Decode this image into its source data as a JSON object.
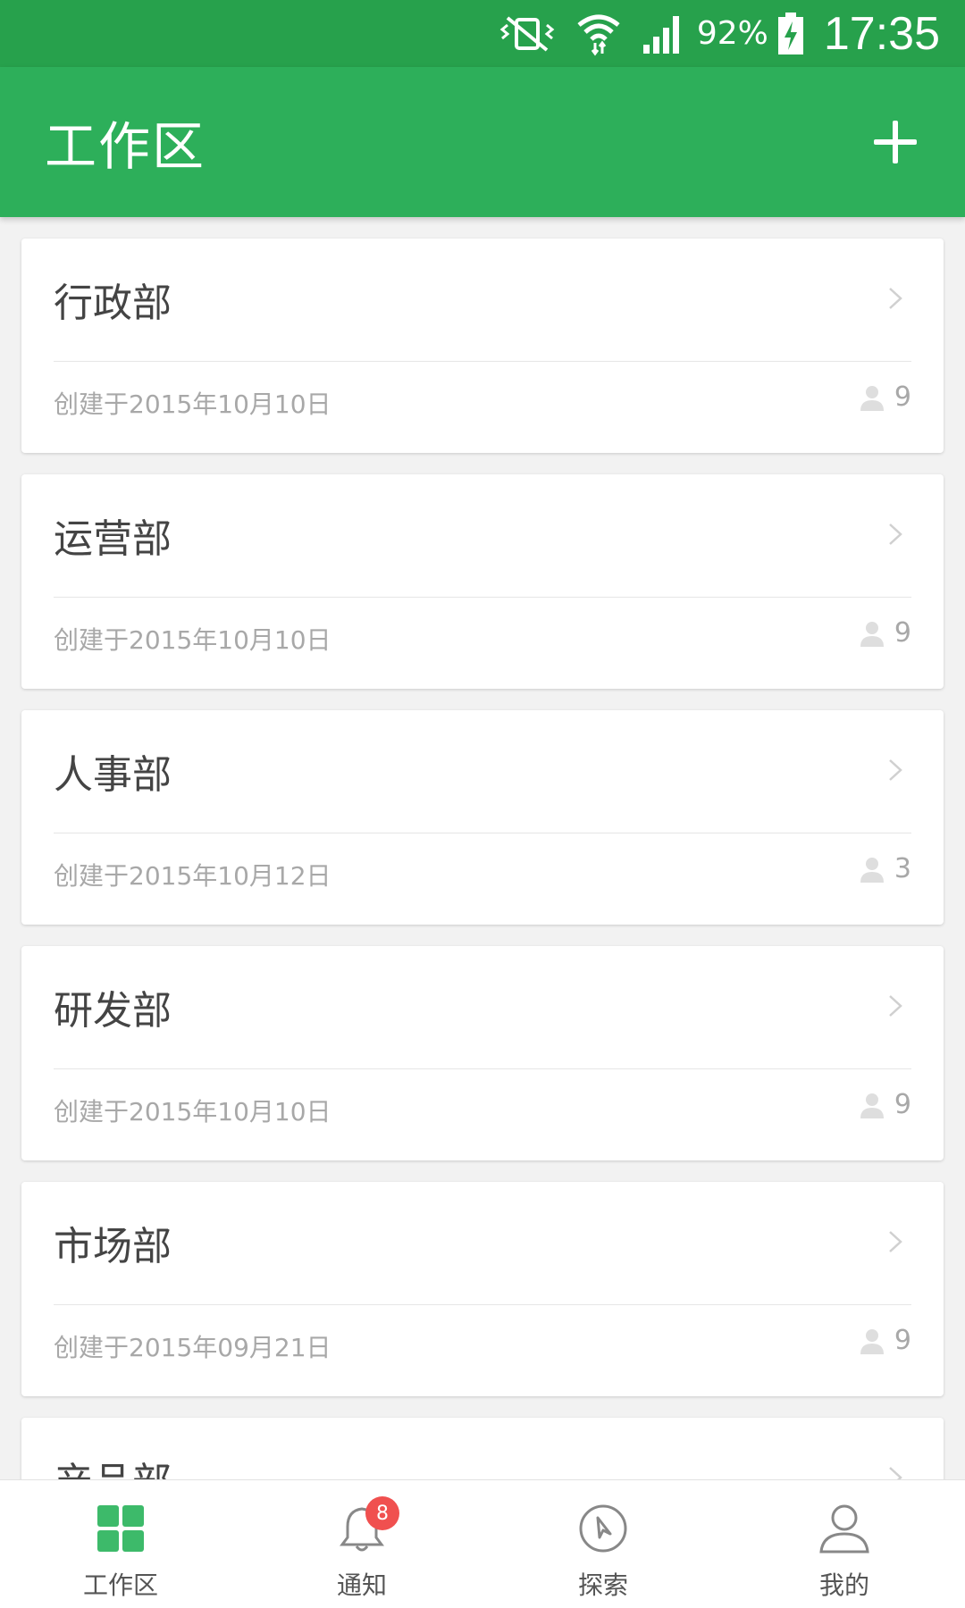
{
  "status_bar": {
    "battery": "92%",
    "time": "17:35"
  },
  "app_bar": {
    "title": "工作区",
    "add_icon": "plus-icon"
  },
  "departments": [
    {
      "name": "行政部",
      "created": "创建于2015年10月10日",
      "members": "9"
    },
    {
      "name": "运营部",
      "created": "创建于2015年10月10日",
      "members": "9"
    },
    {
      "name": "人事部",
      "created": "创建于2015年10月12日",
      "members": "3"
    },
    {
      "name": "研发部",
      "created": "创建于2015年10月10日",
      "members": "9"
    },
    {
      "name": "市场部",
      "created": "创建于2015年09月21日",
      "members": "9"
    },
    {
      "name": "产品部",
      "created": "",
      "members": ""
    }
  ],
  "bottom_nav": [
    {
      "label": "工作区",
      "icon": "grid-icon",
      "active": true
    },
    {
      "label": "通知",
      "icon": "bell-icon",
      "badge": "8"
    },
    {
      "label": "探索",
      "icon": "compass-icon"
    },
    {
      "label": "我的",
      "icon": "person-icon"
    }
  ],
  "colors": {
    "status_bar": "#27a14c",
    "app_bar": "#2daf5a",
    "active_icon": "#3dba6a",
    "badge": "#f0504f"
  }
}
